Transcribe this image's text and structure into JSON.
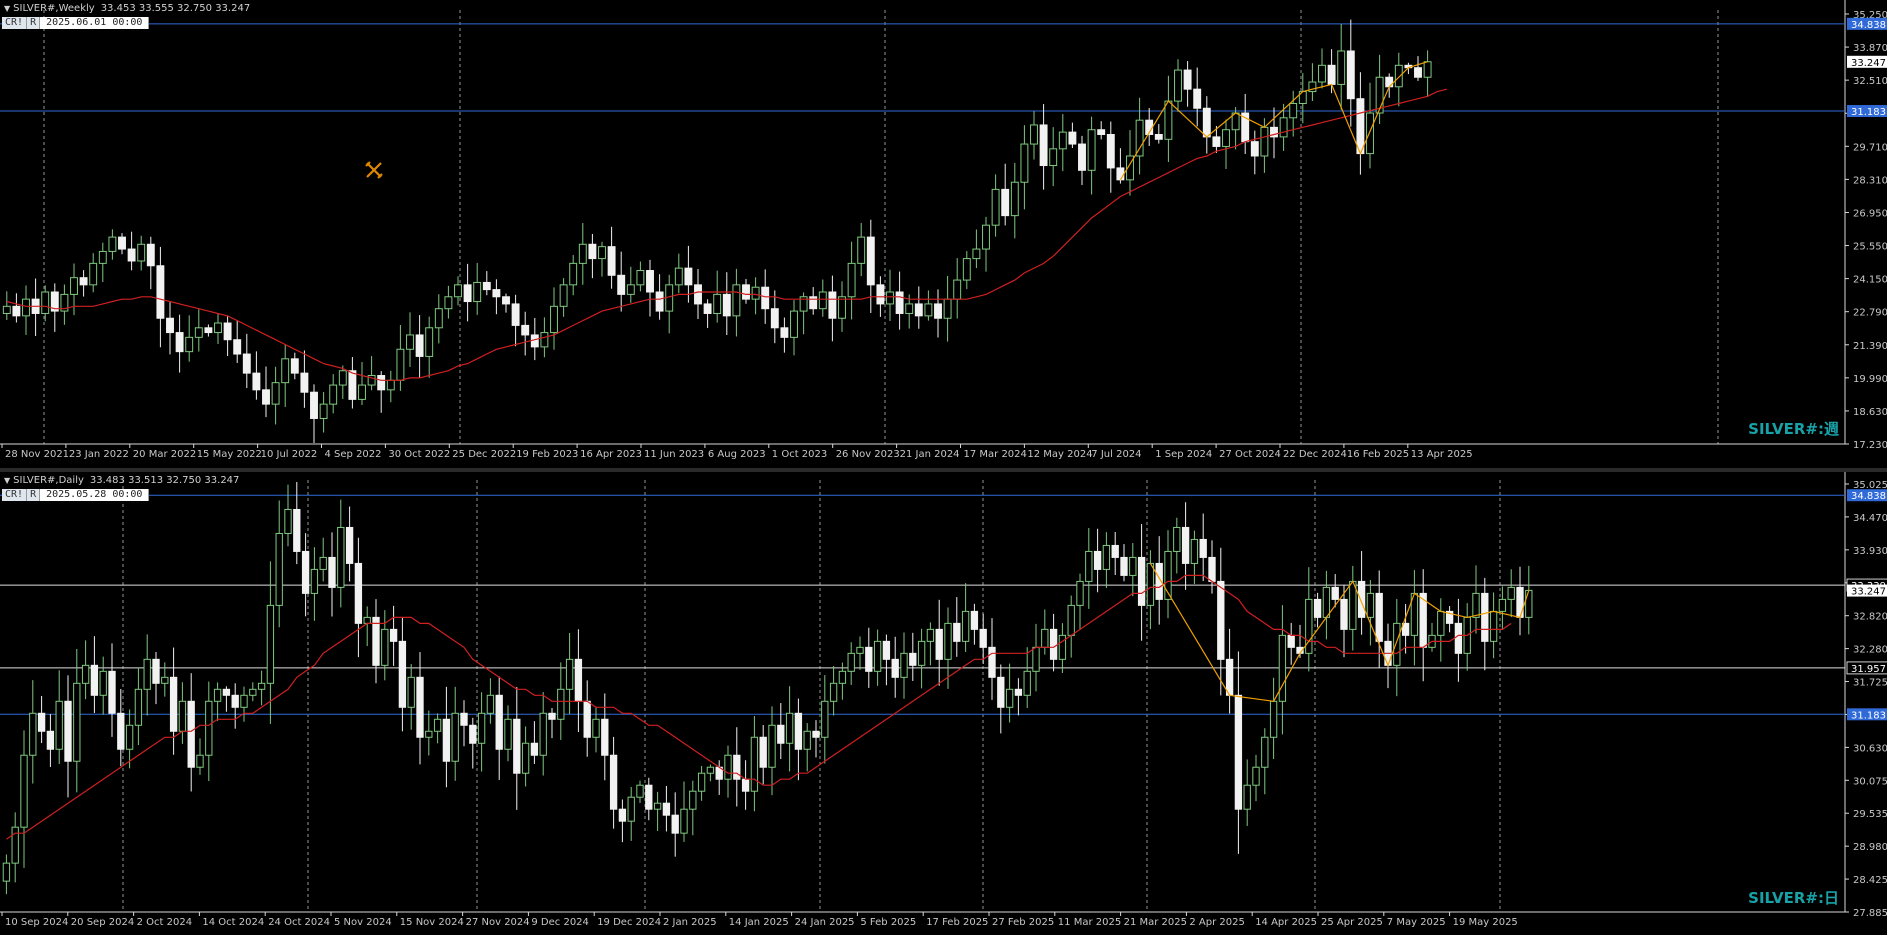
{
  "colors": {
    "bull": "#7fc97f",
    "bear": "#f2f2f2",
    "ma": "#d02020",
    "zigzag": "#f0a000",
    "hline_blue": "#2f6ad8",
    "hline_white": "#e0e0e0",
    "grid": "#c8c8c8",
    "bg": "#000000",
    "axis_text": "#c8c8c8",
    "price_tag_blue": "#2f6ad8"
  },
  "weekly": {
    "header": "SILVER#,Weekly",
    "ohlc": "33.453 33.555 32.750 33.247",
    "tags": [
      "CR!",
      "R"
    ],
    "cursor_date": "2025.06.01 00:00",
    "watermark": "SILVER#:週",
    "icon": "crossed-tools-icon",
    "chart_data": {
      "type": "candlestick",
      "ylim": [
        17.23,
        35.25
      ],
      "y_ticks": [
        "35.250",
        "33.870",
        "32.510",
        "31.150",
        "29.710",
        "28.310",
        "26.950",
        "25.550",
        "24.150",
        "22.790",
        "21.390",
        "19.990",
        "18.630",
        "17.230"
      ],
      "x_ticks": [
        "28 Nov 2021",
        "23 Jan 2022",
        "20 Mar 2022",
        "15 May 2022",
        "10 Jul 2022",
        "4 Sep 2022",
        "30 Oct 2022",
        "25 Dec 2022",
        "19 Feb 2023",
        "16 Apr 2023",
        "11 Jun 2023",
        "6 Aug 2023",
        "1 Oct 2023",
        "26 Nov 2023",
        "21 Jan 2024",
        "17 Mar 2024",
        "12 May 2024",
        "7 Jul 2024",
        "1 Sep 2024",
        "27 Oct 2024",
        "22 Dec 2024",
        "16 Feb 2025",
        "13 Apr 2025"
      ],
      "hlines": [
        {
          "value": 34.838,
          "label": "34.838",
          "style": "blue"
        },
        {
          "value": 31.183,
          "label": "31.183",
          "style": "blue"
        }
      ],
      "current_price": {
        "value": 33.247,
        "label": "33.247"
      },
      "series": [
        {
          "name": "close",
          "values": [
            23.0,
            22.6,
            23.3,
            22.7,
            23.6,
            22.8,
            23.5,
            24.2,
            23.9,
            24.8,
            25.3,
            25.9,
            25.4,
            24.9,
            25.6,
            24.7,
            22.5,
            21.9,
            21.1,
            21.7,
            22.1,
            21.9,
            22.3,
            21.6,
            21.0,
            20.2,
            19.5,
            18.9,
            19.8,
            20.8,
            20.2,
            19.4,
            18.3,
            18.9,
            19.7,
            20.3,
            19.1,
            19.7,
            20.1,
            19.5,
            19.9,
            21.2,
            21.8,
            20.9,
            22.1,
            22.9,
            23.4,
            23.9,
            23.2,
            24.0,
            23.7,
            23.4,
            23.1,
            22.2,
            21.8,
            21.3,
            21.9,
            23.0,
            23.9,
            24.8,
            25.6,
            25.0,
            25.5,
            24.3,
            23.5,
            23.9,
            24.5,
            23.6,
            22.8,
            23.9,
            24.6,
            23.9,
            23.1,
            22.7,
            23.5,
            22.6,
            23.9,
            23.3,
            23.8,
            22.9,
            22.1,
            21.7,
            22.8,
            23.4,
            22.9,
            23.6,
            22.5,
            23.4,
            24.8,
            25.9,
            23.9,
            23.1,
            23.6,
            22.7,
            23.1,
            22.6,
            23.1,
            22.5,
            23.3,
            24.1,
            25.0,
            25.4,
            26.4,
            27.9,
            26.8,
            28.2,
            29.8,
            30.6,
            28.9,
            29.6,
            30.3,
            29.8,
            28.7,
            30.4,
            30.2,
            28.8,
            28.3,
            29.3,
            30.8,
            30.2,
            30.0,
            31.6,
            32.9,
            32.1,
            31.3,
            30.1,
            29.7,
            30.4,
            31.1,
            29.9,
            29.3,
            30.5,
            30.1,
            30.9,
            31.5,
            32.0,
            32.4,
            33.1,
            32.3,
            33.7,
            31.7,
            29.4,
            31.1,
            32.6,
            32.2,
            33.1,
            33.0,
            32.6,
            33.25
          ]
        },
        {
          "name": "MA",
          "values": [
            23.2,
            23.1,
            23.0,
            23.0,
            23.0,
            22.9,
            22.9,
            23.0,
            23.0,
            23.0,
            23.1,
            23.2,
            23.3,
            23.3,
            23.4,
            23.4,
            23.3,
            23.2,
            23.1,
            23.0,
            22.9,
            22.8,
            22.7,
            22.6,
            22.4,
            22.2,
            22.0,
            21.8,
            21.6,
            21.4,
            21.2,
            21.0,
            20.8,
            20.6,
            20.5,
            20.4,
            20.2,
            20.1,
            20.0,
            19.9,
            19.9,
            19.9,
            20.0,
            20.0,
            20.1,
            20.2,
            20.3,
            20.5,
            20.6,
            20.8,
            21.0,
            21.2,
            21.3,
            21.4,
            21.5,
            21.6,
            21.7,
            21.8,
            22.0,
            22.2,
            22.4,
            22.6,
            22.8,
            22.9,
            23.0,
            23.1,
            23.2,
            23.3,
            23.3,
            23.4,
            23.5,
            23.5,
            23.6,
            23.6,
            23.6,
            23.6,
            23.6,
            23.5,
            23.5,
            23.4,
            23.4,
            23.3,
            23.3,
            23.3,
            23.3,
            23.3,
            23.3,
            23.3,
            23.3,
            23.3,
            23.4,
            23.4,
            23.4,
            23.4,
            23.3,
            23.3,
            23.3,
            23.3,
            23.3,
            23.3,
            23.3,
            23.4,
            23.5,
            23.7,
            23.9,
            24.1,
            24.4,
            24.6,
            24.8,
            25.1,
            25.5,
            25.9,
            26.3,
            26.7,
            27.0,
            27.3,
            27.6,
            27.8,
            28.0,
            28.2,
            28.4,
            28.6,
            28.8,
            29.0,
            29.2,
            29.3,
            29.5,
            29.6,
            29.7,
            29.9,
            30.0,
            30.1,
            30.2,
            30.3,
            30.4,
            30.5,
            30.6,
            30.7,
            30.8,
            30.9,
            31.0,
            31.1,
            31.2,
            31.3,
            31.4,
            31.5,
            31.6,
            31.7,
            31.8,
            32.0,
            32.1
          ]
        }
      ]
    }
  },
  "daily": {
    "header": "SILVER#,Daily",
    "ohlc": "33.483 33.513 32.750 33.247",
    "tags": [
      "CR!",
      "R"
    ],
    "cursor_date": "2025.05.28 00:00",
    "watermark": "SILVER#:日",
    "chart_data": {
      "type": "candlestick",
      "ylim": [
        27.885,
        35.025
      ],
      "y_ticks": [
        "35.025",
        "34.470",
        "33.930",
        "33.375",
        "32.820",
        "32.280",
        "31.725",
        "31.170",
        "30.630",
        "30.075",
        "29.535",
        "28.980",
        "28.425",
        "27.885"
      ],
      "x_ticks": [
        "10 Sep 2024",
        "20 Sep 2024",
        "2 Oct 2024",
        "14 Oct 2024",
        "24 Oct 2024",
        "5 Nov 2024",
        "15 Nov 2024",
        "27 Nov 2024",
        "9 Dec 2024",
        "19 Dec 2024",
        "2 Jan 2025",
        "14 Jan 2025",
        "24 Jan 2025",
        "5 Feb 2025",
        "17 Feb 2025",
        "27 Feb 2025",
        "11 Mar 2025",
        "21 Mar 2025",
        "2 Apr 2025",
        "14 Apr 2025",
        "25 Apr 2025",
        "7 May 2025",
        "19 May 2025"
      ],
      "hlines": [
        {
          "value": 34.838,
          "label": "34.838",
          "style": "blue"
        },
        {
          "value": 33.339,
          "label": "33.339",
          "style": "white"
        },
        {
          "value": 31.957,
          "label": "31.957",
          "style": "white"
        },
        {
          "value": 31.183,
          "label": "31.183",
          "style": "blue"
        }
      ],
      "current_price": {
        "value": 33.247,
        "label": "33.247"
      },
      "series": [
        {
          "name": "close",
          "values": [
            28.7,
            29.3,
            30.5,
            31.2,
            30.9,
            30.6,
            31.4,
            30.4,
            31.7,
            32.0,
            31.5,
            31.9,
            31.2,
            30.6,
            31.0,
            31.6,
            32.1,
            31.7,
            31.8,
            30.9,
            31.4,
            30.3,
            30.5,
            31.4,
            31.6,
            31.5,
            31.3,
            31.5,
            31.6,
            31.7,
            33.0,
            34.2,
            34.6,
            33.9,
            33.2,
            33.6,
            33.8,
            33.3,
            34.3,
            33.7,
            32.7,
            32.8,
            32.0,
            32.6,
            32.4,
            31.3,
            31.8,
            30.8,
            30.9,
            31.1,
            30.4,
            31.2,
            31.0,
            30.7,
            31.2,
            31.5,
            30.6,
            31.1,
            30.2,
            30.7,
            30.5,
            31.2,
            31.1,
            31.6,
            32.1,
            31.4,
            30.8,
            31.1,
            30.5,
            29.6,
            29.4,
            29.8,
            30.0,
            29.6,
            29.7,
            29.5,
            29.2,
            29.6,
            29.9,
            30.2,
            30.3,
            30.1,
            30.5,
            30.1,
            29.9,
            30.8,
            30.3,
            31.0,
            30.7,
            31.2,
            30.6,
            30.9,
            30.8,
            31.4,
            31.7,
            31.9,
            32.2,
            32.3,
            31.9,
            32.4,
            32.1,
            31.8,
            32.2,
            32.0,
            32.4,
            32.6,
            32.1,
            32.7,
            32.4,
            32.9,
            32.6,
            32.3,
            31.8,
            31.3,
            31.6,
            31.5,
            31.9,
            32.3,
            32.6,
            32.1,
            32.5,
            33.0,
            33.4,
            33.9,
            33.6,
            34.0,
            33.8,
            33.5,
            33.8,
            33.0,
            33.7,
            33.1,
            33.9,
            34.3,
            33.7,
            34.1,
            33.8,
            33.4,
            32.1,
            31.5,
            29.6,
            30.0,
            30.3,
            30.8,
            31.4,
            32.5,
            32.3,
            32.2,
            33.1,
            32.8,
            33.3,
            33.1,
            32.6,
            33.4,
            32.8,
            33.2,
            32.4,
            32.0,
            32.7,
            32.5,
            33.2,
            32.3,
            32.5,
            32.9,
            32.7,
            32.2,
            32.8,
            33.2,
            32.4,
            32.9,
            33.1,
            33.3,
            32.8,
            33.25
          ]
        },
        {
          "name": "MA",
          "values": [
            29.1,
            29.2,
            29.2,
            29.3,
            29.4,
            29.5,
            29.6,
            29.7,
            29.8,
            29.9,
            30.0,
            30.1,
            30.2,
            30.3,
            30.4,
            30.5,
            30.6,
            30.7,
            30.8,
            30.8,
            30.9,
            30.9,
            31.0,
            31.0,
            31.1,
            31.1,
            31.1,
            31.2,
            31.2,
            31.3,
            31.4,
            31.5,
            31.6,
            31.8,
            31.9,
            32.0,
            32.2,
            32.3,
            32.4,
            32.5,
            32.6,
            32.7,
            32.7,
            32.7,
            32.8,
            32.8,
            32.8,
            32.7,
            32.7,
            32.6,
            32.5,
            32.4,
            32.3,
            32.1,
            32.0,
            31.9,
            31.8,
            31.7,
            31.6,
            31.6,
            31.5,
            31.5,
            31.4,
            31.4,
            31.4,
            31.4,
            31.4,
            31.3,
            31.3,
            31.3,
            31.2,
            31.2,
            31.1,
            31.0,
            31.0,
            30.9,
            30.8,
            30.7,
            30.6,
            30.5,
            30.4,
            30.3,
            30.2,
            30.2,
            30.1,
            30.1,
            30.0,
            30.0,
            30.1,
            30.1,
            30.2,
            30.2,
            30.3,
            30.4,
            30.5,
            30.6,
            30.7,
            30.8,
            30.9,
            31.0,
            31.1,
            31.2,
            31.3,
            31.4,
            31.5,
            31.6,
            31.7,
            31.8,
            31.9,
            32.0,
            32.1,
            32.1,
            32.2,
            32.2,
            32.2,
            32.2,
            32.2,
            32.3,
            32.3,
            32.3,
            32.4,
            32.5,
            32.6,
            32.7,
            32.8,
            32.9,
            33.0,
            33.1,
            33.2,
            33.2,
            33.3,
            33.3,
            33.4,
            33.4,
            33.5,
            33.5,
            33.5,
            33.4,
            33.3,
            33.2,
            33.1,
            32.9,
            32.8,
            32.7,
            32.6,
            32.6,
            32.5,
            32.5,
            32.4,
            32.4,
            32.3,
            32.3,
            32.2,
            32.2,
            32.2,
            32.2,
            32.2,
            32.2,
            32.2,
            32.3,
            32.3,
            32.3,
            32.4,
            32.4,
            32.4,
            32.5,
            32.5,
            32.6,
            32.6,
            32.6,
            32.6,
            32.7
          ]
        }
      ]
    }
  }
}
